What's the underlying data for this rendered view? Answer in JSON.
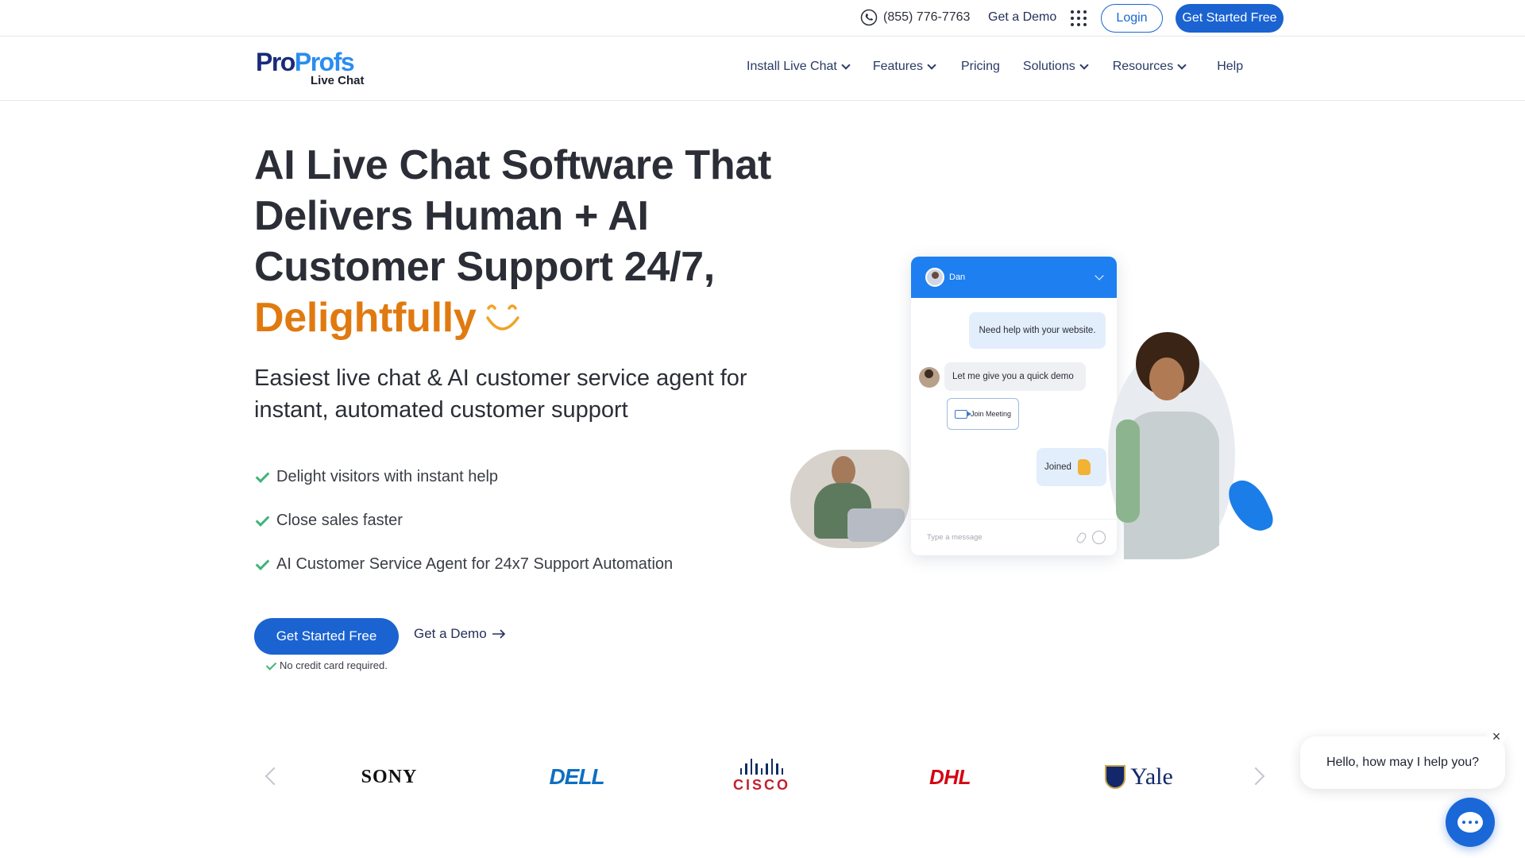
{
  "topbar": {
    "phone": "(855) 776-7763",
    "demo": "Get a Demo",
    "login": "Login",
    "get_started": "Get Started Free"
  },
  "logo": {
    "line1a": "Pro",
    "line1b": "Profs",
    "line2": "Live Chat"
  },
  "nav": [
    {
      "label": "Install Live Chat",
      "dropdown": true
    },
    {
      "label": "Features",
      "dropdown": true
    },
    {
      "label": "Pricing",
      "dropdown": false
    },
    {
      "label": "Solutions",
      "dropdown": true
    },
    {
      "label": "Resources",
      "dropdown": true
    },
    {
      "label": "Help",
      "dropdown": false
    }
  ],
  "hero": {
    "title_line1": "AI Live Chat Software That",
    "title_line2": "Delivers Human + AI",
    "title_line3": "Customer Support 24/7,",
    "title_highlight": "Delightfully",
    "subtitle": "Easiest live chat & AI customer service agent for instant, automated customer support",
    "bullets": [
      "Delight visitors with instant help",
      "Close sales faster",
      "AI Customer Service Agent for 24x7 Support Automation"
    ],
    "cta_primary": "Get Started Free",
    "cta_secondary": "Get a Demo",
    "note": "No credit card required."
  },
  "chat_mock": {
    "agent_name": "Dan",
    "msg_visitor": "Need help with your website.",
    "msg_agent": "Let me give you a quick demo",
    "join_label": "Join Meeting",
    "msg_joined": "Joined",
    "input_placeholder": "Type a message"
  },
  "logos": [
    "SONY",
    "DELL",
    "CISCO",
    "DHL",
    "Yale"
  ],
  "widget": {
    "greeting": "Hello, how may I help you?",
    "close": "×"
  },
  "colors": {
    "primary": "#1a63d1",
    "accent_orange": "#e07a10",
    "check_green": "#3fb47a"
  }
}
